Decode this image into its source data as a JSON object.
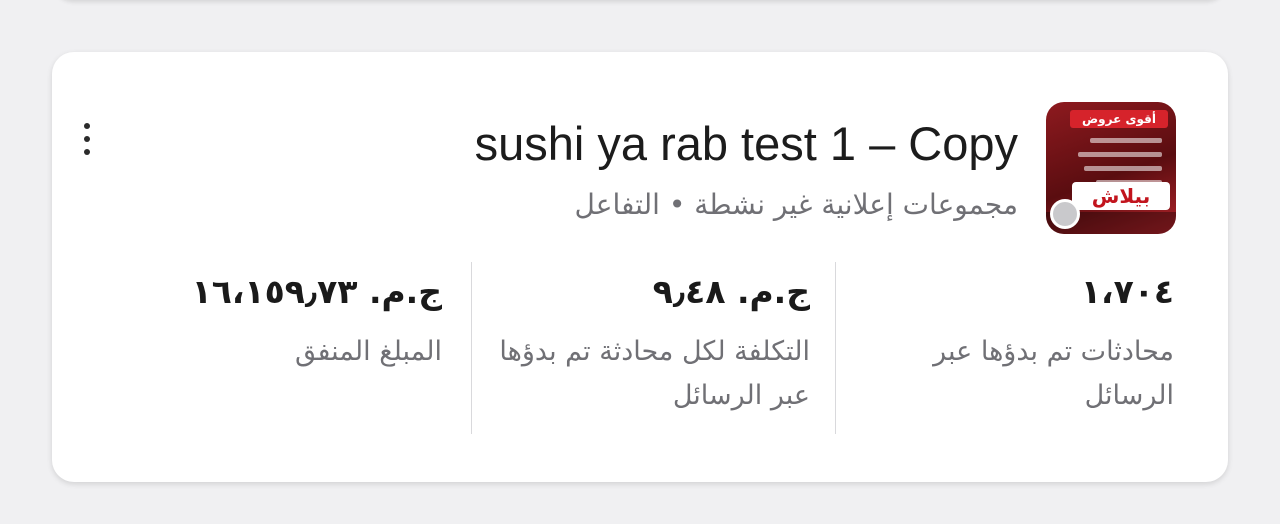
{
  "campaign": {
    "title": "sushi ya rab test 1 – Copy",
    "subtitle": "مجموعات إعلانية غير نشطة • التفاعل",
    "thumbnail": {
      "banner_text": "أقوى عروض",
      "big_text": "بيلاش"
    },
    "status_color": "#c9c9cc"
  },
  "metrics": [
    {
      "value": "١،٧٠٤",
      "label": "محادثات تم بدؤها عبر الرسائل"
    },
    {
      "value": "ج.م. ٩٫٤٨",
      "label": "التكلفة لكل محادثة تم بدؤها عبر الرسائل"
    },
    {
      "value": "ج.م. ١٦،١٥٩٫٧٣",
      "label": "المبلغ المنفق"
    }
  ],
  "icons": {
    "more": "more-vertical-icon"
  }
}
